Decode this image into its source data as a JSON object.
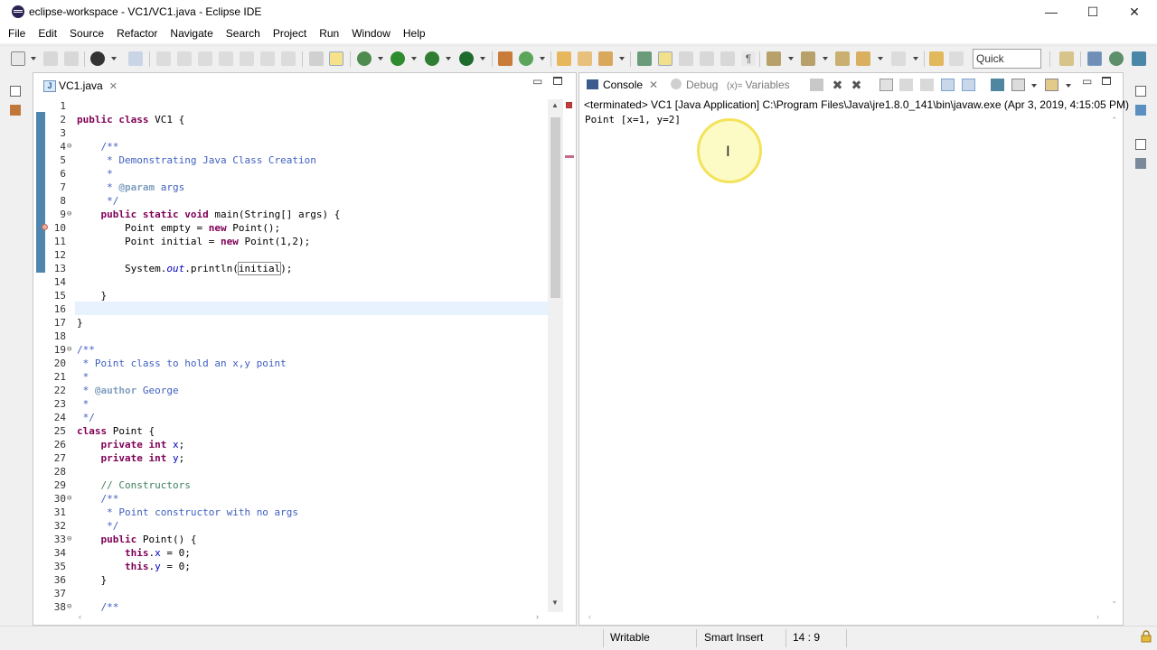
{
  "window": {
    "title": "eclipse-workspace - VC1/VC1.java - Eclipse IDE",
    "minimize_glyph": "—",
    "maximize_glyph": "☐",
    "close_glyph": "✕"
  },
  "menubar": {
    "items": [
      "File",
      "Edit",
      "Source",
      "Refactor",
      "Navigate",
      "Search",
      "Project",
      "Run",
      "Window",
      "Help"
    ]
  },
  "toolbar": {
    "quick_access": "Quick Access"
  },
  "editor": {
    "tab_label": "VC1.java",
    "tab_icon": "J",
    "lines": [
      {
        "n": "1",
        "fold": "",
        "html": ""
      },
      {
        "n": "2",
        "fold": "",
        "html": "<span class=\"kw\">public class</span> VC1 {"
      },
      {
        "n": "3",
        "fold": "",
        "html": ""
      },
      {
        "n": "4",
        "fold": "⊖",
        "html": "    <span class=\"jd\">/**</span>"
      },
      {
        "n": "5",
        "fold": "",
        "html": "     <span class=\"jd\">* Demonstrating Java Class Creation</span>"
      },
      {
        "n": "6",
        "fold": "",
        "html": "     <span class=\"jd\">*</span>"
      },
      {
        "n": "7",
        "fold": "",
        "html": "     <span class=\"jd\">* </span><span class=\"tag\">@param</span><span class=\"jd\"> args</span>"
      },
      {
        "n": "8",
        "fold": "",
        "html": "     <span class=\"jd\">*/</span>"
      },
      {
        "n": "9",
        "fold": "⊖",
        "html": "    <span class=\"kw\">public static void</span> main(String[] args) {"
      },
      {
        "n": "10",
        "fold": "",
        "html": "        Point empty = <span class=\"kw\">new</span> Point();"
      },
      {
        "n": "11",
        "fold": "",
        "html": "        Point initial = <span class=\"kw\">new</span> Point(1,2);"
      },
      {
        "n": "12",
        "fold": "",
        "html": ""
      },
      {
        "n": "13",
        "fold": "",
        "html": "        System.<span class=\"fld it\">out</span>.println(<span style=\"outline:1px solid #888\">initial</span>);"
      },
      {
        "n": "14",
        "fold": "",
        "html": ""
      },
      {
        "n": "15",
        "fold": "",
        "html": "    }"
      },
      {
        "n": "16",
        "fold": "",
        "html": ""
      },
      {
        "n": "17",
        "fold": "",
        "html": "}"
      },
      {
        "n": "18",
        "fold": "",
        "html": ""
      },
      {
        "n": "19",
        "fold": "⊖",
        "html": "<span class=\"jd\">/**</span>"
      },
      {
        "n": "20",
        "fold": "",
        "html": " <span class=\"jd\">* Point class to hold an x,y point</span>"
      },
      {
        "n": "21",
        "fold": "",
        "html": " <span class=\"jd\">*</span>"
      },
      {
        "n": "22",
        "fold": "",
        "html": " <span class=\"jd\">* </span><span class=\"tag\">@author</span><span class=\"jd\"> George</span>"
      },
      {
        "n": "23",
        "fold": "",
        "html": " <span class=\"jd\">*</span>"
      },
      {
        "n": "24",
        "fold": "",
        "html": " <span class=\"jd\">*/</span>"
      },
      {
        "n": "25",
        "fold": "",
        "html": "<span class=\"kw\">class</span> Point {"
      },
      {
        "n": "26",
        "fold": "",
        "html": "    <span class=\"kw\">private int</span> <span class=\"fld\">x</span>;"
      },
      {
        "n": "27",
        "fold": "",
        "html": "    <span class=\"kw\">private int</span> <span class=\"fld\">y</span>;"
      },
      {
        "n": "28",
        "fold": "",
        "html": ""
      },
      {
        "n": "29",
        "fold": "",
        "html": "    <span class=\"cm\">// Constructors</span>"
      },
      {
        "n": "30",
        "fold": "⊖",
        "html": "    <span class=\"jd\">/**</span>"
      },
      {
        "n": "31",
        "fold": "",
        "html": "     <span class=\"jd\">* Point constructor with no args</span>"
      },
      {
        "n": "32",
        "fold": "",
        "html": "     <span class=\"jd\">*/</span>"
      },
      {
        "n": "33",
        "fold": "⊖",
        "html": "    <span class=\"kw\">public</span> Point() {"
      },
      {
        "n": "34",
        "fold": "",
        "html": "        <span class=\"kw\">this</span>.<span class=\"fld\">x</span> = 0;"
      },
      {
        "n": "35",
        "fold": "",
        "html": "        <span class=\"kw\">this</span>.<span class=\"fld\">y</span> = 0;"
      },
      {
        "n": "36",
        "fold": "",
        "html": "    }"
      },
      {
        "n": "37",
        "fold": "",
        "html": ""
      },
      {
        "n": "38",
        "fold": "⊖",
        "html": "    <span class=\"jd\">/**</span>"
      }
    ]
  },
  "console": {
    "tabs": {
      "console": "Console",
      "debug": "Debug",
      "variables": "Variables",
      "variables_prefix": "(x)="
    },
    "header": "<terminated> VC1 [Java Application] C:\\Program Files\\Java\\jre1.8.0_141\\bin\\javaw.exe (Apr 3, 2019, 4:15:05 PM)",
    "output": "Point [x=1, y=2]"
  },
  "statusbar": {
    "writable": "Writable",
    "insert_mode": "Smart Insert",
    "position": "14 : 9"
  },
  "colors": {
    "keyword": "#7f0055",
    "javadoc": "#3f5fbf",
    "field": "#0000c0",
    "change_bar": "#4f86b0",
    "cursor_highlight": "#f3e35c"
  }
}
